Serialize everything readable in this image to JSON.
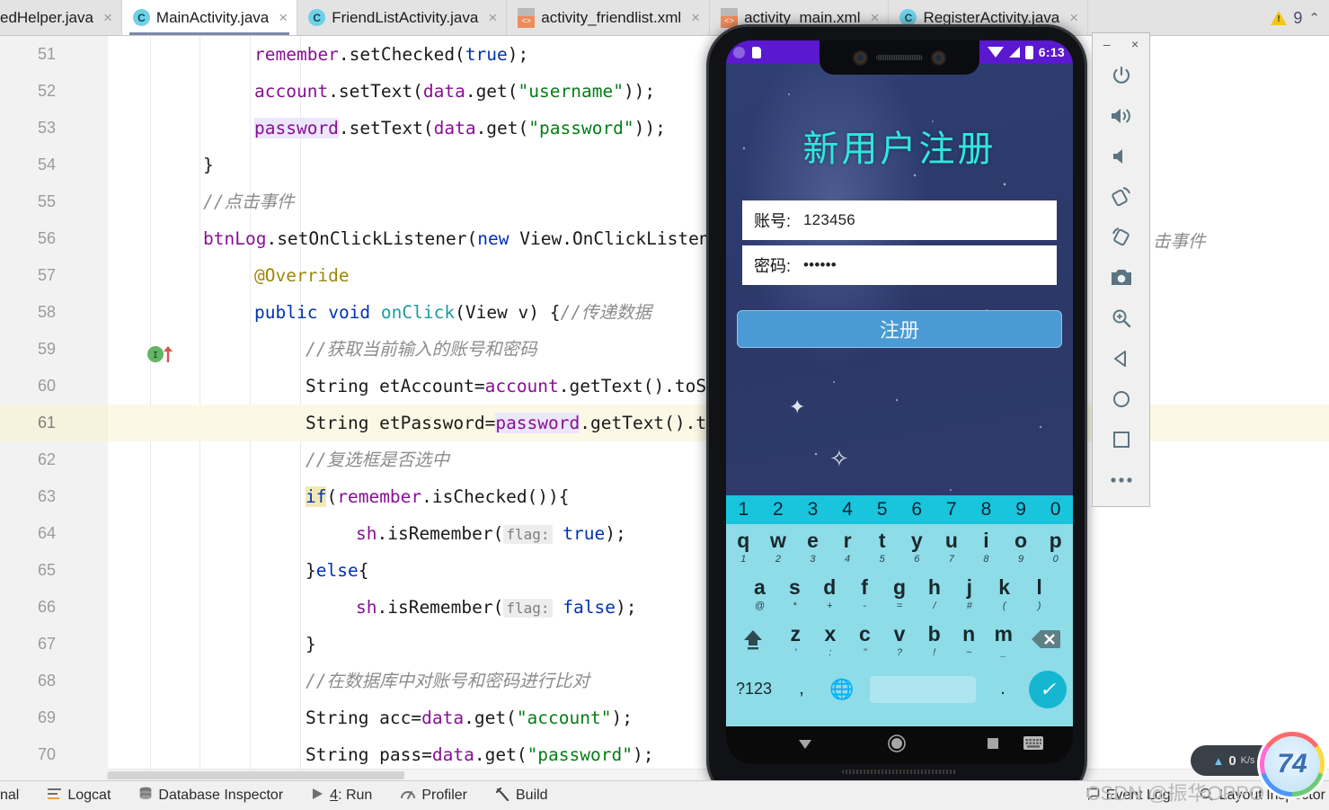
{
  "tabs": [
    {
      "label": "edHelper.java",
      "icon": "java-class-icon",
      "active": false,
      "truncated": true
    },
    {
      "label": "MainActivity.java",
      "icon": "java-class-icon",
      "active": true
    },
    {
      "label": "FriendListActivity.java",
      "icon": "java-class-icon",
      "active": false
    },
    {
      "label": "activity_friendlist.xml",
      "icon": "xml-layout-icon",
      "active": false
    },
    {
      "label": "activity_main.xml",
      "icon": "xml-layout-icon",
      "active": false
    },
    {
      "label": "RegisterActivity.java",
      "icon": "java-class-icon",
      "active": false
    }
  ],
  "inspection": {
    "warning_icon": "warning-triangle-icon",
    "warning_count": "9",
    "collapse_icon": "chevron-up-icon"
  },
  "editor": {
    "lines": [
      {
        "n": "51",
        "indent": 2,
        "text": "remember.setChecked(true);"
      },
      {
        "n": "52",
        "indent": 2,
        "text": "account.setText(data.get(\"username\"));"
      },
      {
        "n": "53",
        "indent": 2,
        "text": "password.setText(data.get(\"password\"));"
      },
      {
        "n": "54",
        "indent": 1,
        "text": "}"
      },
      {
        "n": "55",
        "indent": 1,
        "text": "//点击事件"
      },
      {
        "n": "56",
        "indent": 1,
        "text": "btnLog.setOnClickListener(new View.OnClickListener() {"
      },
      {
        "n": "57",
        "indent": 2,
        "text": "@Override"
      },
      {
        "n": "58",
        "indent": 2,
        "text": "public void onClick(View v) {//传递数据"
      },
      {
        "n": "59",
        "indent": 3,
        "text": "//获取当前输入的账号和密码"
      },
      {
        "n": "60",
        "indent": 3,
        "text": "String etAccount=account.getText().toString();"
      },
      {
        "n": "61",
        "indent": 3,
        "text": "String etPassword=password.getText().toString();",
        "highlighted": true
      },
      {
        "n": "62",
        "indent": 3,
        "text": "//复选框是否选中"
      },
      {
        "n": "63",
        "indent": 3,
        "text": "if(remember.isChecked()){"
      },
      {
        "n": "64",
        "indent": 4,
        "text": "sh.isRemember( flag: true);"
      },
      {
        "n": "65",
        "indent": 3,
        "text": "}else{"
      },
      {
        "n": "66",
        "indent": 4,
        "text": "sh.isRemember( flag: false);"
      },
      {
        "n": "67",
        "indent": 3,
        "text": "}"
      },
      {
        "n": "68",
        "indent": 3,
        "text": "//在数据库中对账号和密码进行比对"
      },
      {
        "n": "69",
        "indent": 3,
        "text": "String acc=data.get(\"account\");"
      },
      {
        "n": "70",
        "indent": 3,
        "text": "String pass=data.get(\"password\");"
      }
    ],
    "hidden_comment_fragment": "击事件"
  },
  "emulator": {
    "window_controls": {
      "minimize": "–",
      "close": "×"
    },
    "toolbar_buttons": [
      {
        "name": "power-icon",
        "label": "Power"
      },
      {
        "name": "volume-up-icon",
        "label": "Volume Up"
      },
      {
        "name": "volume-down-icon",
        "label": "Volume Down"
      },
      {
        "name": "rotate-left-icon",
        "label": "Rotate Left"
      },
      {
        "name": "rotate-right-icon",
        "label": "Rotate Right"
      },
      {
        "name": "screenshot-camera-icon",
        "label": "Take Screenshot"
      },
      {
        "name": "zoom-icon",
        "label": "Zoom Mode"
      },
      {
        "name": "back-triangle-icon",
        "label": "Back"
      },
      {
        "name": "home-circle-icon",
        "label": "Home"
      },
      {
        "name": "overview-square-icon",
        "label": "Overview"
      },
      {
        "name": "more-dots-icon",
        "label": "More"
      }
    ],
    "status_bar": {
      "time": "6:13",
      "icons": [
        "purple-dot-icon",
        "sim-card-icon",
        "wifi-icon",
        "signal-icon",
        "battery-icon"
      ]
    },
    "app": {
      "title": "新用户注册",
      "title_color": "#2ee8e0",
      "fields": [
        {
          "label": "账号:",
          "value": "123456",
          "name": "account-field"
        },
        {
          "label": "密码:",
          "value": "••••••",
          "name": "password-field"
        }
      ],
      "register_button": "注册",
      "button_color": "#4a9bd4"
    },
    "keyboard": {
      "number_row": [
        "1",
        "2",
        "3",
        "4",
        "5",
        "6",
        "7",
        "8",
        "9",
        "0"
      ],
      "row1": [
        {
          "k": "q",
          "s": "1"
        },
        {
          "k": "w",
          "s": "2"
        },
        {
          "k": "e",
          "s": "3"
        },
        {
          "k": "r",
          "s": "4"
        },
        {
          "k": "t",
          "s": "5"
        },
        {
          "k": "y",
          "s": "6"
        },
        {
          "k": "u",
          "s": "7"
        },
        {
          "k": "i",
          "s": "8"
        },
        {
          "k": "o",
          "s": "9"
        },
        {
          "k": "p",
          "s": "0"
        }
      ],
      "row2": [
        {
          "k": "a",
          "s": "@"
        },
        {
          "k": "s",
          "s": "*"
        },
        {
          "k": "d",
          "s": "+"
        },
        {
          "k": "f",
          "s": "-"
        },
        {
          "k": "g",
          "s": "="
        },
        {
          "k": "h",
          "s": "/"
        },
        {
          "k": "j",
          "s": "#"
        },
        {
          "k": "k",
          "s": "("
        },
        {
          "k": "l",
          "s": ")"
        }
      ],
      "row3": [
        {
          "k": "z",
          "s": "'"
        },
        {
          "k": "x",
          "s": ":"
        },
        {
          "k": "c",
          "s": "\""
        },
        {
          "k": "v",
          "s": "?"
        },
        {
          "k": "b",
          "s": "!"
        },
        {
          "k": "n",
          "s": "~"
        },
        {
          "k": "m",
          "s": "_"
        }
      ],
      "shift_icon": "shift-up-icon",
      "backspace_icon": "backspace-icon",
      "symbols_key": "?123",
      "comma_key": ",",
      "globe_icon": "globe-language-icon",
      "period_key": ".",
      "enter_icon": "check-enter-icon",
      "number_row_color": "#19c5dd",
      "body_color": "#8ddce8"
    },
    "nav_bar": {
      "back_icon": "nav-back-icon",
      "home_icon": "nav-home-icon",
      "recents_icon": "nav-recents-icon",
      "keyboard_icon": "nav-keyboard-icon"
    }
  },
  "bottom_bar": {
    "items": [
      {
        "label": "nal",
        "icon": "terminal-icon",
        "name": "terminal-tool"
      },
      {
        "label": "Logcat",
        "icon": "logcat-icon",
        "name": "logcat-tool"
      },
      {
        "label": "Database Inspector",
        "icon": "database-icon",
        "name": "database-inspector-tool"
      },
      {
        "label": "4: Run",
        "icon": "run-triangle-icon",
        "name": "run-tool",
        "mnemonic": "4"
      },
      {
        "label": "Profiler",
        "icon": "profiler-icon",
        "name": "profiler-tool"
      },
      {
        "label": "Build",
        "icon": "build-hammer-icon",
        "name": "build-tool"
      }
    ],
    "right_items": [
      {
        "label": "Event Log",
        "icon": "event-log-icon",
        "name": "event-log-tool"
      },
      {
        "label": "Layout Inspector",
        "icon": "layout-inspector-icon",
        "name": "layout-inspector-tool"
      }
    ]
  },
  "overlay": {
    "watermark": "CSDN @振华OPPO",
    "net_speed": "0",
    "net_speed_unit": "K/s",
    "net_up_icon": "upload-arrow-icon",
    "game_badge": "74"
  }
}
